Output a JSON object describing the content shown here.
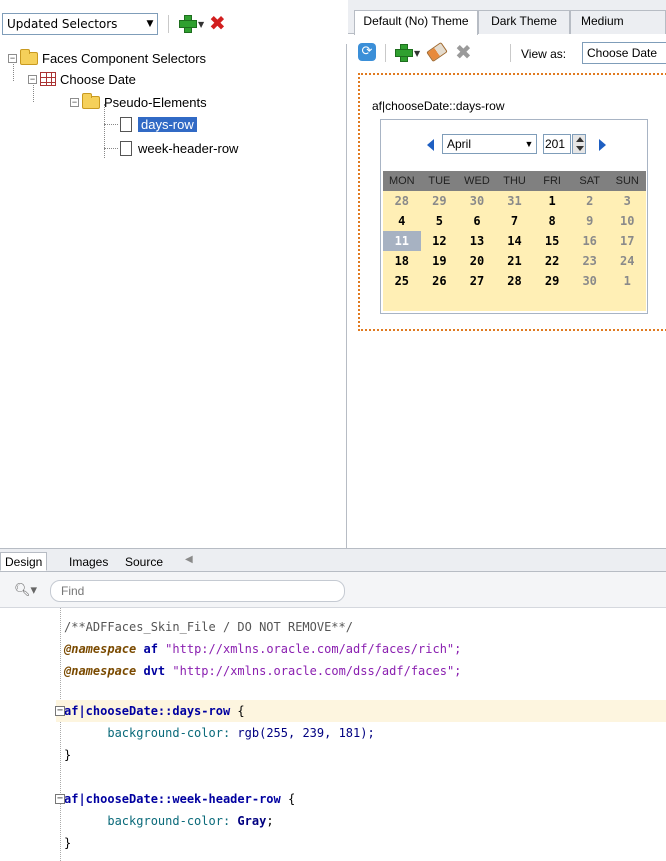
{
  "left_panel": {
    "selector_combo": "Updated Selectors",
    "tree": {
      "root": "Faces Component Selectors",
      "component": "Choose Date",
      "group": "Pseudo-Elements",
      "items": [
        "days-row",
        "week-header-row"
      ]
    }
  },
  "right_panel": {
    "theme_tabs": [
      "Default (No) Theme",
      "Dark Theme",
      "Medium"
    ],
    "view_as_label": "View as:",
    "view_as_value": "Choose Date",
    "preview": {
      "selector_label": "af|chooseDate::days-row",
      "month": "April",
      "year": "201",
      "weekdays": [
        "MON",
        "TUE",
        "WED",
        "THU",
        "FRI",
        "SAT",
        "SUN"
      ],
      "weeks": [
        [
          "28",
          "29",
          "30",
          "31",
          "1",
          "2",
          "3"
        ],
        [
          "4",
          "5",
          "6",
          "7",
          "8",
          "9",
          "10"
        ],
        [
          "11",
          "12",
          "13",
          "14",
          "15",
          "16",
          "17"
        ],
        [
          "18",
          "19",
          "20",
          "21",
          "22",
          "23",
          "24"
        ],
        [
          "25",
          "26",
          "27",
          "28",
          "29",
          "30",
          "1"
        ]
      ],
      "selected_day": "11",
      "days_row_color": "#ffefb5",
      "week_header_color": "#808080"
    }
  },
  "editor_tabs": [
    "Design",
    "Images",
    "Source"
  ],
  "find": {
    "placeholder": "Find"
  },
  "code": {
    "comment": "/**ADFFaces_Skin_File / DO NOT REMOVE**/",
    "ns_keyword": "@namespace",
    "ns1_prefix": "af",
    "ns1_uri": "\"http://xmlns.oracle.com/adf/faces/rich\";",
    "ns2_prefix": "dvt",
    "ns2_uri": "\"http://xmlns.oracle.com/dss/adf/faces\";",
    "rule1_selector": "af|chooseDate::days-row",
    "rule1_property": "background-color:",
    "rule1_value": "rgb(255, 239, 181);",
    "rule2_selector": "af|chooseDate::week-header-row",
    "rule2_property": "background-color:",
    "rule2_value": "Gray",
    "open_brace": " {",
    "close_brace": "}",
    "semicolon": ";"
  }
}
